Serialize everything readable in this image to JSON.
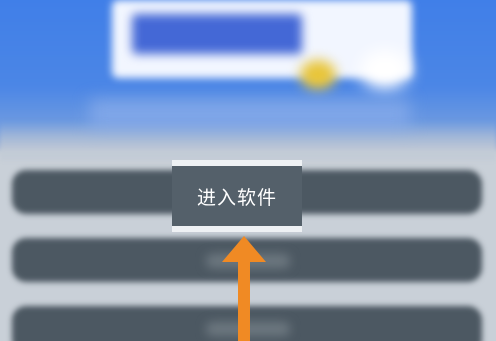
{
  "menu": {
    "enter_software_label": "进入软件"
  },
  "annotation": {
    "arrow_color": "#f08a24",
    "arrow_icon": "arrow-up-icon"
  },
  "colors": {
    "banner": "#4a85e6",
    "row": "#4c5862",
    "highlight_border": "#eef1f4"
  }
}
